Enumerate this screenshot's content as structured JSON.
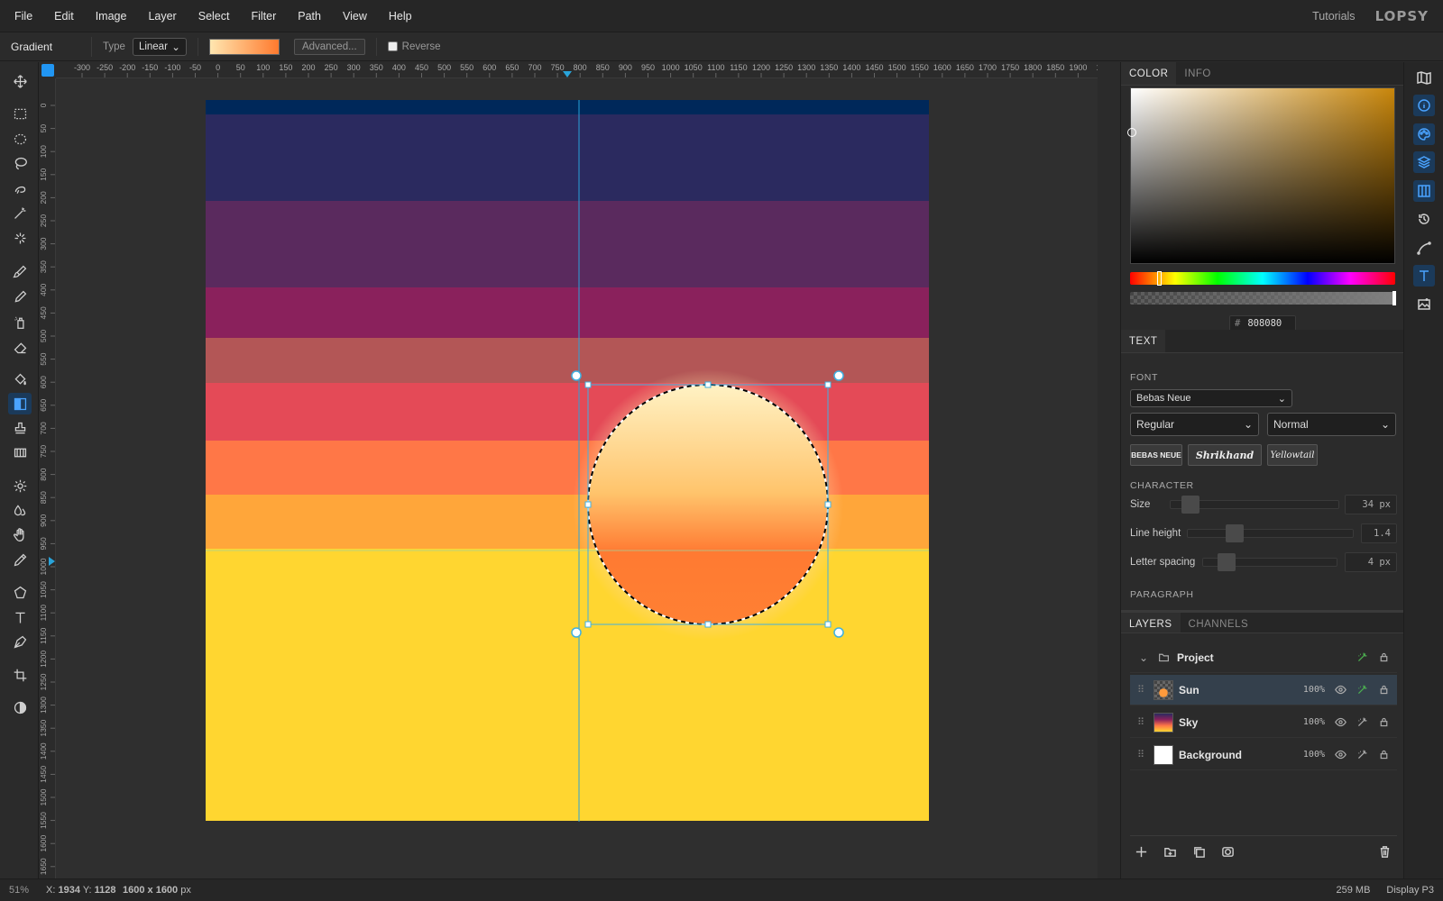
{
  "menubar": {
    "items": [
      "File",
      "Edit",
      "Image",
      "Layer",
      "Select",
      "Filter",
      "Path",
      "View",
      "Help"
    ],
    "tutorials": "Tutorials",
    "logo": "LOPSY"
  },
  "options": {
    "tool_name": "Gradient",
    "type_label": "Type",
    "type_value": "Linear",
    "advanced_label": "Advanced...",
    "reverse_label": "Reverse",
    "reverse_checked": false,
    "gradient_colors": [
      "#ffe6b0",
      "#ff7a2e"
    ]
  },
  "rulers": {
    "top_ticks": [
      "-300",
      "-250",
      "-200",
      "-150",
      "-100",
      "-50",
      "0",
      "50",
      "100",
      "150",
      "200",
      "250",
      "300",
      "350",
      "400",
      "450",
      "500",
      "550",
      "600",
      "650",
      "700",
      "750",
      "800",
      "850",
      "900",
      "950",
      "1000",
      "1050",
      "1100",
      "1150",
      "1200",
      "1250",
      "1300",
      "1350",
      "1400",
      "1450",
      "1500",
      "1550",
      "1600",
      "1650",
      "1700",
      "1750",
      "1800",
      "1850",
      "1900",
      "19"
    ],
    "left_ticks": [
      "0",
      "50",
      "100",
      "150",
      "200",
      "250",
      "300",
      "350",
      "400",
      "450",
      "500",
      "550",
      "600",
      "650",
      "700",
      "750",
      "800",
      "850",
      "900",
      "950",
      "1000",
      "1050",
      "1100",
      "1150",
      "1200",
      "1250",
      "1300",
      "1350",
      "1400",
      "1450",
      "1500",
      "1550",
      "1600",
      "1650"
    ]
  },
  "canvas": {
    "sky_bands": [
      "#00285a",
      "#2b2a5f",
      "#5a2a5e",
      "#8a215c",
      "#b35656",
      "#e44a57",
      "#ff7747",
      "#ffa63a",
      "#ffd630"
    ],
    "sun_colors": [
      "#fff2c4",
      "#ffc46c",
      "#ff7a32"
    ]
  },
  "status": {
    "zoom": "51%",
    "x_label": "X:",
    "x_value": "1934",
    "y_label": "Y:",
    "y_value": "1128",
    "doc_size": "1600 x 1600",
    "doc_unit": "px",
    "memory": "259 MB",
    "profile": "Display P3"
  },
  "color_panel": {
    "tabs": [
      "COLOR",
      "INFO"
    ],
    "hex_value": "808080"
  },
  "text_panel": {
    "tab": "TEXT",
    "font_heading": "FONT",
    "font_family": "Bebas Neue",
    "font_style": "Regular",
    "font_variant": "Normal",
    "font_chips": [
      "BEBAS NEUE",
      "Shrikhand",
      "Yellowtail"
    ],
    "character_heading": "CHARACTER",
    "size_label": "Size",
    "size_value": "34 px",
    "line_height_label": "Line height",
    "line_height_value": "1.4",
    "letter_spacing_label": "Letter spacing",
    "letter_spacing_value": "4 px",
    "paragraph_heading": "PARAGRAPH"
  },
  "layers_panel": {
    "tabs": [
      "LAYERS",
      "CHANNELS"
    ],
    "group": "Project",
    "layers": [
      {
        "name": "Sun",
        "opacity": "100%",
        "selected": true
      },
      {
        "name": "Sky",
        "opacity": "100%",
        "selected": false
      },
      {
        "name": "Background",
        "opacity": "100%",
        "selected": false
      }
    ]
  },
  "tools": [
    "move",
    "rect-select",
    "ellipse-select",
    "lasso",
    "magnetic-lasso",
    "magic-wand",
    "quick-select",
    "brush",
    "pencil",
    "spray",
    "eraser",
    "fill",
    "gradient",
    "stamp",
    "pattern",
    "dodge",
    "burn",
    "hand",
    "eyedropper",
    "shape",
    "text",
    "pen",
    "crop",
    "contrast"
  ],
  "right_sidebar": [
    "map-icon",
    "info-icon",
    "palette-icon",
    "layers-icon",
    "channels-icon",
    "history-icon",
    "path-icon",
    "text-icon",
    "image-icon"
  ]
}
